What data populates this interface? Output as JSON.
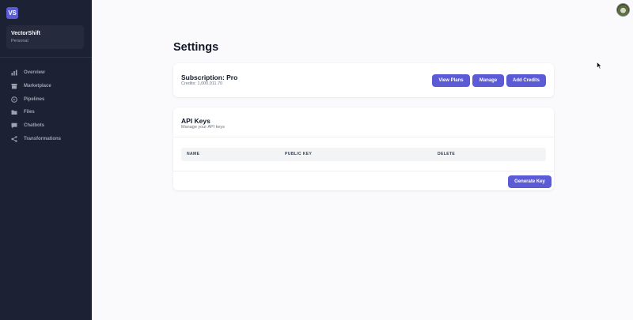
{
  "sidebar": {
    "logo_text": "VS",
    "org": {
      "name": "VectorShift",
      "type": "Personal"
    },
    "items": [
      {
        "label": "Overview",
        "icon": "bar-chart-icon"
      },
      {
        "label": "Marketplace",
        "icon": "store-icon"
      },
      {
        "label": "Pipelines",
        "icon": "pipeline-icon"
      },
      {
        "label": "Files",
        "icon": "folder-icon"
      },
      {
        "label": "Chatbots",
        "icon": "chat-icon"
      },
      {
        "label": "Transformations",
        "icon": "transform-icon"
      }
    ]
  },
  "page": {
    "title": "Settings"
  },
  "subscription": {
    "title": "Subscription: Pro",
    "credits": "Credits: 1,000,011.70",
    "view_plans_label": "View Plans",
    "manage_label": "Manage",
    "add_credits_label": "Add Credits"
  },
  "api_keys": {
    "title": "API Keys",
    "subtitle": "Manage your API keys",
    "columns": [
      "NAME",
      "PUBLIC KEY",
      "DELETE"
    ],
    "generate_label": "Generate Key"
  },
  "colors": {
    "sidebar_bg": "#1c2233",
    "accent": "#5b5bd6",
    "page_bg": "#fafafc"
  }
}
